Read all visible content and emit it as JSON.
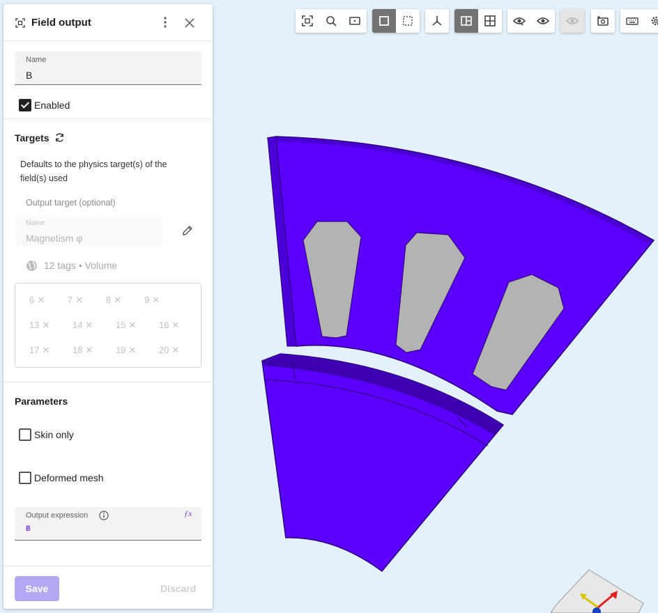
{
  "panel": {
    "title": "Field output",
    "name_field": {
      "label": "Name",
      "value": "B"
    },
    "enabled": {
      "label": "Enabled",
      "checked": true
    }
  },
  "targets": {
    "title": "Targets",
    "description": "Defaults to the physics target(s) of the field(s) used",
    "output_target_label": "Output target (optional)",
    "name_label": "Name",
    "name_value": "Magnetism φ",
    "tags_summary": "12 tags • Volume",
    "tags": [
      "6",
      "7",
      "8",
      "9",
      "13",
      "14",
      "15",
      "16",
      "17",
      "18",
      "19",
      "20"
    ]
  },
  "parameters": {
    "title": "Parameters",
    "skin_only": {
      "label": "Skin only",
      "checked": false
    },
    "deformed_mesh": {
      "label": "Deformed mesh",
      "checked": false
    },
    "output_expression": {
      "label": "Output expression",
      "value": "B"
    }
  },
  "actions": {
    "save": "Save",
    "discard": "Discard"
  },
  "toolbar": {
    "groups": [
      [
        "focus-selection-icon",
        "zoom-fit-icon",
        "frame-icon"
      ],
      [
        "solid-view-icon",
        "wireframe-view-icon"
      ],
      [
        "axes-icon"
      ],
      [
        "section-view-icon",
        "grid-view-icon"
      ],
      [
        "hide-icon",
        "show-icon",
        "show-all-icon"
      ],
      [
        "screenshot-icon"
      ],
      [
        "keyboard-icon",
        "settings-icon"
      ]
    ]
  },
  "colors": {
    "accent": "#b6a7f4",
    "model": "#5b00ff",
    "model_dark": "#3d00b0",
    "slot": "#b3b3b3",
    "background": "#e3f1fc",
    "expression_text": "#7b3fe4"
  }
}
